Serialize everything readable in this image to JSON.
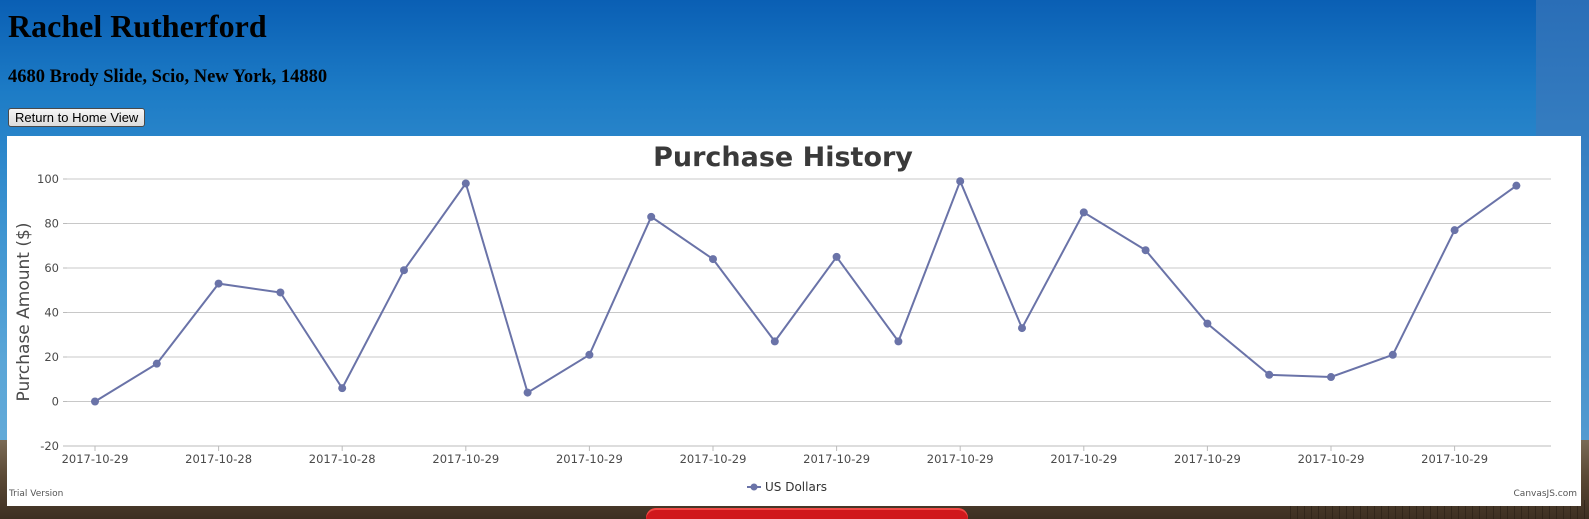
{
  "header": {
    "name": "Rachel Rutherford",
    "address": "4680 Brody Slide, Scio, New York, 14880",
    "home_button_label": "Return to Home View"
  },
  "chart_data": {
    "type": "line",
    "title": "Purchase History",
    "xlabel": "",
    "ylabel": "Purchase Amount ($)",
    "ylim": [
      -20,
      100
    ],
    "y_ticks": [
      -20,
      0,
      20,
      40,
      60,
      80,
      100
    ],
    "grid": true,
    "x_tick_labels": [
      "2017-10-29",
      "2017-10-28",
      "2017-10-28",
      "2017-10-29",
      "2017-10-29",
      "2017-10-29",
      "2017-10-29",
      "2017-10-29",
      "2017-10-29",
      "2017-10-29",
      "2017-10-29",
      "2017-10-29"
    ],
    "legend_position": "bottom",
    "line_color": "#6a73a8",
    "series": [
      {
        "name": "US Dollars",
        "values": [
          0,
          17,
          53,
          49,
          6,
          59,
          98,
          4,
          21,
          83,
          64,
          27,
          65,
          27,
          99,
          33,
          85,
          68,
          35,
          12,
          11,
          21,
          77,
          97
        ]
      }
    ],
    "footer_left": "Trial Version",
    "footer_right": "CanvasJS.com"
  }
}
